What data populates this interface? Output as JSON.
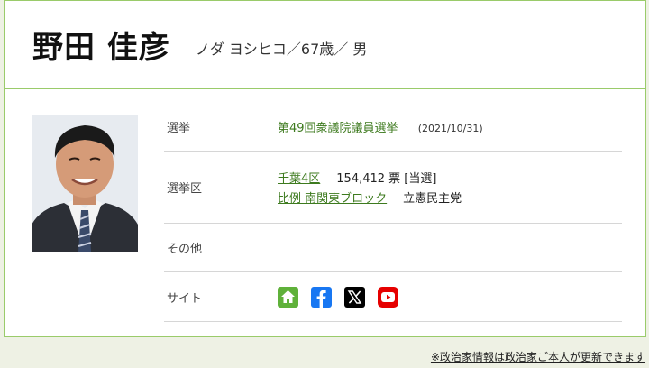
{
  "profile": {
    "name": "野田 佳彦",
    "kana_age_gender": "ノダ ヨシヒコ／67歳／ 男"
  },
  "rows": {
    "election": {
      "label": "選挙",
      "name": "第49回衆議院議員選挙",
      "date": "(2021/10/31)"
    },
    "district": {
      "label": "選挙区",
      "constituency": "千葉4区",
      "votes": "154,412 票 [当選]",
      "pr_block": "比例 南関東ブロック",
      "party": "立憲民主党"
    },
    "other": {
      "label": "その他"
    },
    "site": {
      "label": "サイト",
      "icons": [
        "home-icon",
        "facebook-icon",
        "x-icon",
        "youtube-icon"
      ]
    }
  },
  "footnote": "※政治家情報は政治家ご本人が更新できます",
  "colors": {
    "accent_green": "#9acb6a",
    "link_green": "#3d7a1e",
    "page_bg": "#eef1e4",
    "facebook": "#1877f2",
    "youtube": "#e60000"
  }
}
